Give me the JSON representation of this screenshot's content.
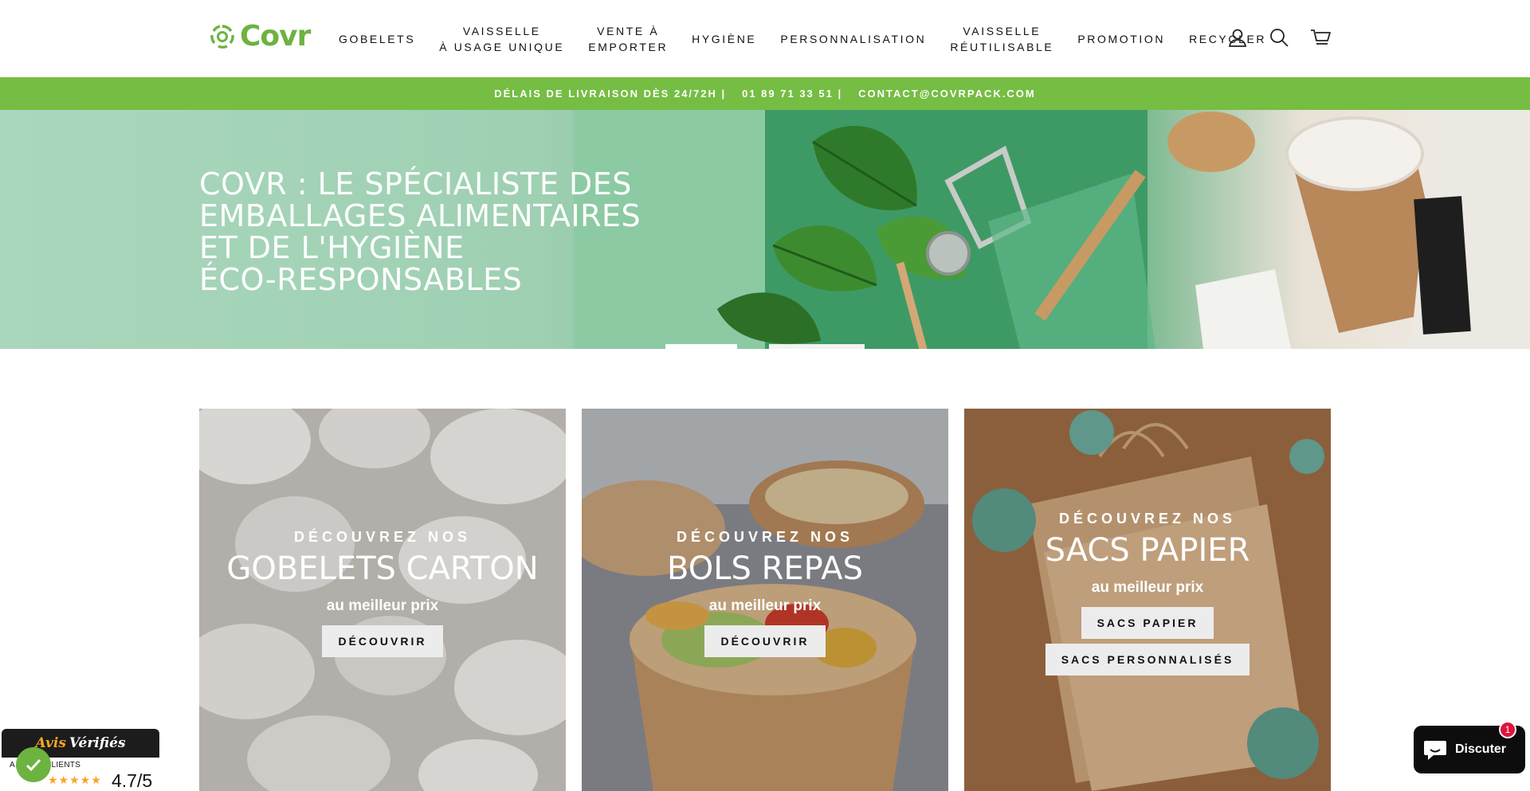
{
  "brand": {
    "name": "Covr",
    "color": "#6cb33f"
  },
  "nav": {
    "items": [
      {
        "label": "GOBELETS",
        "label2": ""
      },
      {
        "label": "VAISSELLE",
        "label2": "À USAGE UNIQUE"
      },
      {
        "label": "VENTE À",
        "label2": "EMPORTER"
      },
      {
        "label": "HYGIÈNE",
        "label2": ""
      },
      {
        "label": "PERSONNALISATION",
        "label2": ""
      },
      {
        "label": "VAISSELLE",
        "label2": "RÉUTILISABLE"
      },
      {
        "label": "PROMOTION",
        "label2": ""
      },
      {
        "label": "RECYCLER",
        "label2": ""
      }
    ],
    "icons": [
      "user-icon",
      "search-icon",
      "cart-icon"
    ]
  },
  "announcement": {
    "delivery": "DÉLAIS DE LIVRAISON DÈS 24/72H |",
    "phone": "01 89 71 33 51 |",
    "email": "CONTACT@COVRPACK.COM",
    "background": "#76bd44"
  },
  "hero": {
    "line1": "COVR : LE SPÉCIALISTE DES",
    "line2": "EMBALLAGES ALIMENTAIRES",
    "line3": "ET DE L'HYGIÈNE",
    "line4": "ÉCO-RESPONSABLES",
    "active_slide": 1,
    "slide_count": 2
  },
  "cards": [
    {
      "kicker": "DÉCOUVREZ NOS",
      "title": "GOBELETS CARTON",
      "subtitle": "au meilleur prix",
      "buttons": [
        "DÉCOUVRIR"
      ]
    },
    {
      "kicker": "DÉCOUVREZ NOS",
      "title": "BOLS REPAS",
      "subtitle": "au meilleur prix",
      "buttons": [
        "DÉCOUVRIR"
      ]
    },
    {
      "kicker": "DÉCOUVREZ NOS",
      "title": "SACS PAPIER",
      "subtitle": "au meilleur prix",
      "buttons": [
        "SACS PAPIER",
        "SACS PERSONNALISÉS"
      ]
    }
  ],
  "reviews": {
    "title_part1": "Avis",
    "title_part2": "Vérifiés",
    "label": "A... NOS CLIENTS",
    "stars": "★★★★★",
    "score": "4.7/5"
  },
  "chat": {
    "label": "Discuter",
    "badge": "1"
  }
}
